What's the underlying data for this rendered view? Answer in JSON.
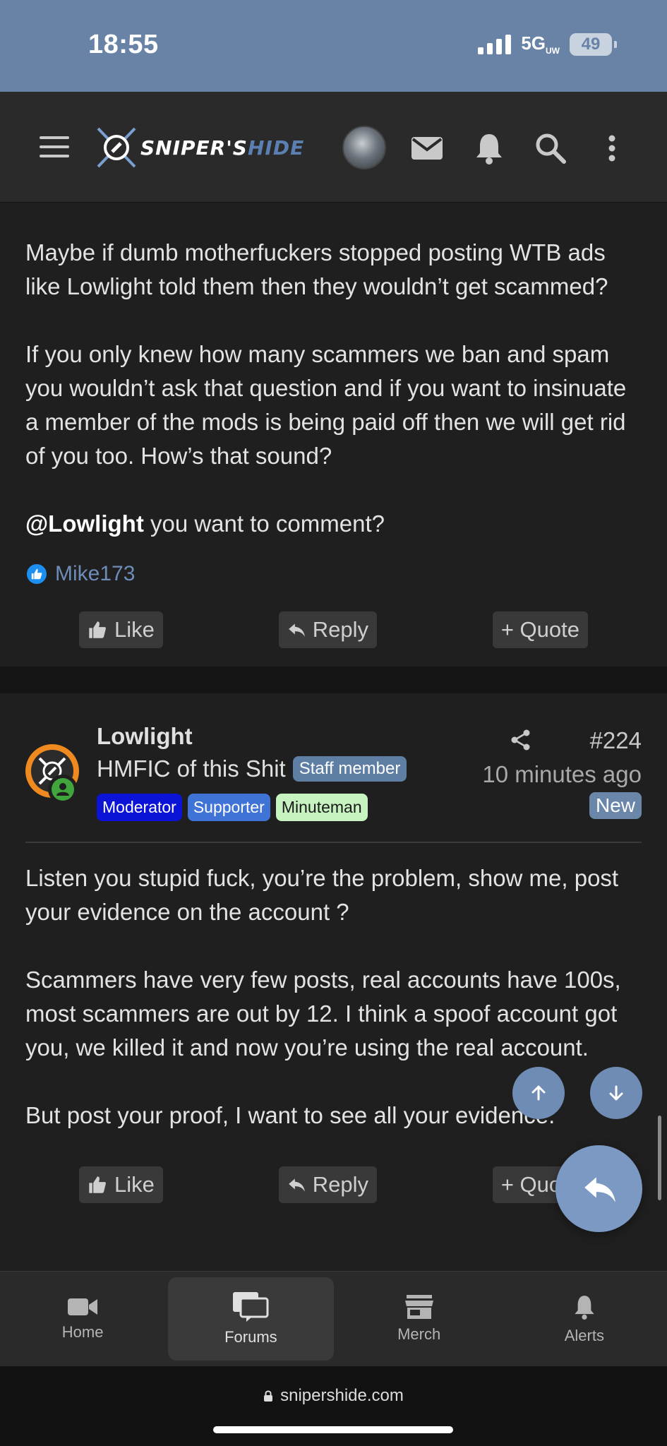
{
  "status_bar": {
    "time": "18:55",
    "network": "5G",
    "network_sup": "UW",
    "battery": "49"
  },
  "header": {
    "logo_main": "SNIPER'S",
    "logo_accent": "HIDE"
  },
  "post1": {
    "paragraphs": [
      "Maybe if dumb motherfuckers stopped posting WTB ads like Lowlight told them then they wouldn’t get scammed?",
      "If you only knew how many scammers we ban and spam you wouldn’t ask that question and if you want to insinuate a member of the mods is being paid off then we will get rid of you too. How’s that sound?"
    ],
    "mention": "@Lowlight",
    "mention_rest": " you want to comment?",
    "reactor": "Mike173",
    "actions": {
      "like": "Like",
      "reply": "Reply",
      "quote": "+ Quote"
    }
  },
  "post2": {
    "author": "Lowlight",
    "title": "HMFIC of this Shit",
    "staff_badge": "Staff member",
    "badges": [
      "Moderator",
      "Supporter",
      "Minuteman"
    ],
    "post_number": "#224",
    "time": "10 minutes ago",
    "new_label": "New",
    "paragraphs": [
      "Listen you stupid fuck, you’re the problem, show me, post your evidence on the account ?",
      "Scammers have very few posts, real accounts have 100s, most scammers are out by 12. I think a spoof account got you, we killed it and now you’re using the real account.",
      "But post your proof, I want to see all your evidence."
    ],
    "actions": {
      "like": "Like",
      "reply": "Reply",
      "quote": "+ Quote"
    }
  },
  "tabbar": {
    "home": "Home",
    "forums": "Forums",
    "merch": "Merch",
    "alerts": "Alerts"
  },
  "url": "snipershide.com",
  "colors": {
    "status_bar": "#6883a6",
    "background": "#1f1f20",
    "accent": "#6f8db4"
  }
}
